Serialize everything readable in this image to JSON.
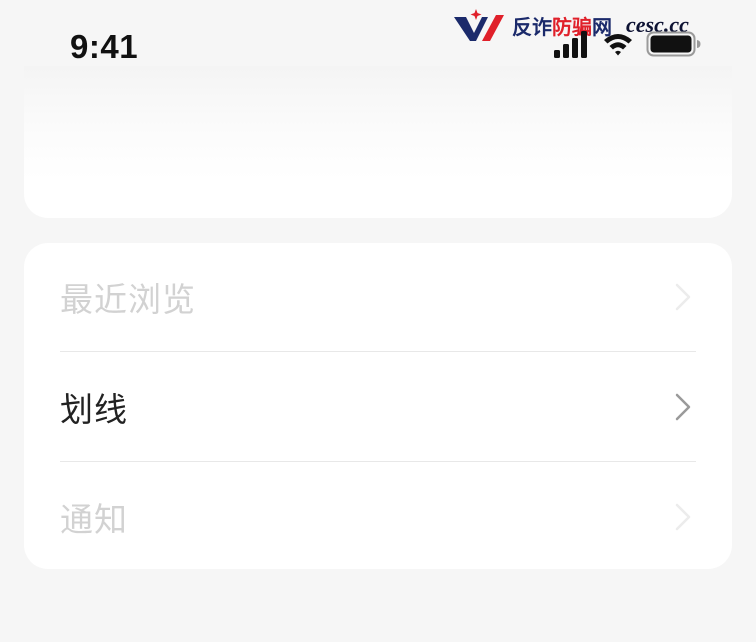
{
  "status_bar": {
    "time": "9:41",
    "icons": [
      "signal-icon",
      "wifi-icon",
      "battery-icon"
    ]
  },
  "watermark": {
    "logo": "anti-fraud-logo",
    "text_part1": "反诈",
    "text_part2": "防骗",
    "text_part3": "网",
    "url": "cesc.cc",
    "colors": {
      "navy": "#1b2a6b",
      "red": "#e0202a"
    }
  },
  "menu": {
    "items": [
      {
        "label": "最近浏览",
        "state": "faded"
      },
      {
        "label": "划线",
        "state": "active"
      },
      {
        "label": "通知",
        "state": "faded"
      }
    ]
  },
  "colors": {
    "background": "#f6f6f6",
    "card": "#ffffff",
    "active_text": "#222222",
    "faded_text": "#d2d2d2",
    "chevron_active": "#9a9a9a"
  }
}
